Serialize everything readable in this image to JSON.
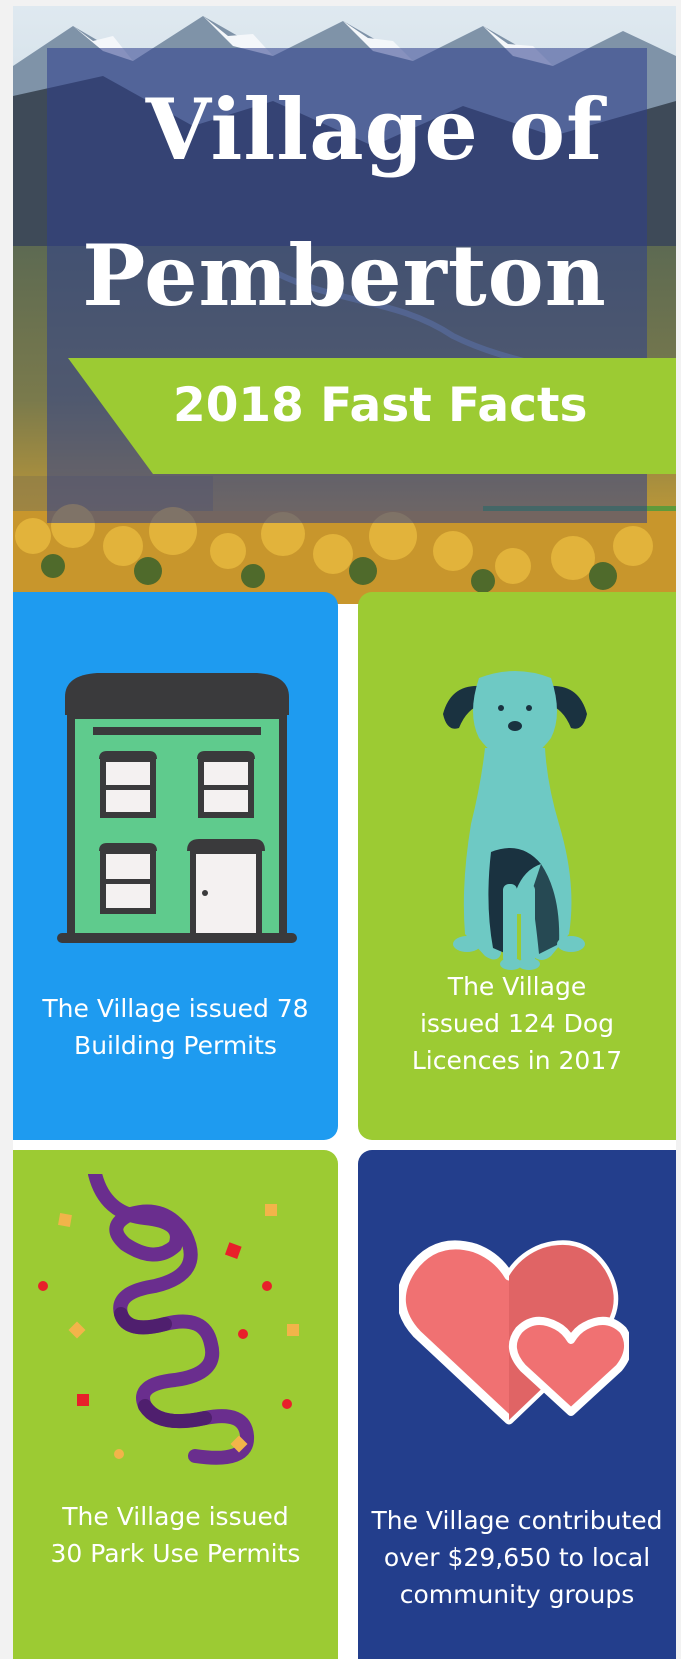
{
  "hero": {
    "title_line1": "Village of",
    "title_line2": "Pemberton",
    "subtitle": "2018 Fast Facts"
  },
  "tiles": [
    {
      "icon": "building-icon",
      "color": "#1e9bf0",
      "lines": [
        "The Village issued 78",
        "Building Permits"
      ]
    },
    {
      "icon": "dog-icon",
      "color": "#9ccb33",
      "lines": [
        "The Village",
        "issued 124 Dog",
        "Licences in 2017"
      ]
    },
    {
      "icon": "confetti-icon",
      "color": "#9ccb33",
      "lines": [
        "The Village issued",
        "30 Park Use Permits"
      ]
    },
    {
      "icon": "hearts-icon",
      "color": "#233e8c",
      "lines": [
        "The Village contributed",
        "over $29,650 to local",
        "community groups"
      ]
    }
  ],
  "colors": {
    "blue": "#1e9bf0",
    "green": "#9ccb33",
    "navy": "#233e8c"
  }
}
